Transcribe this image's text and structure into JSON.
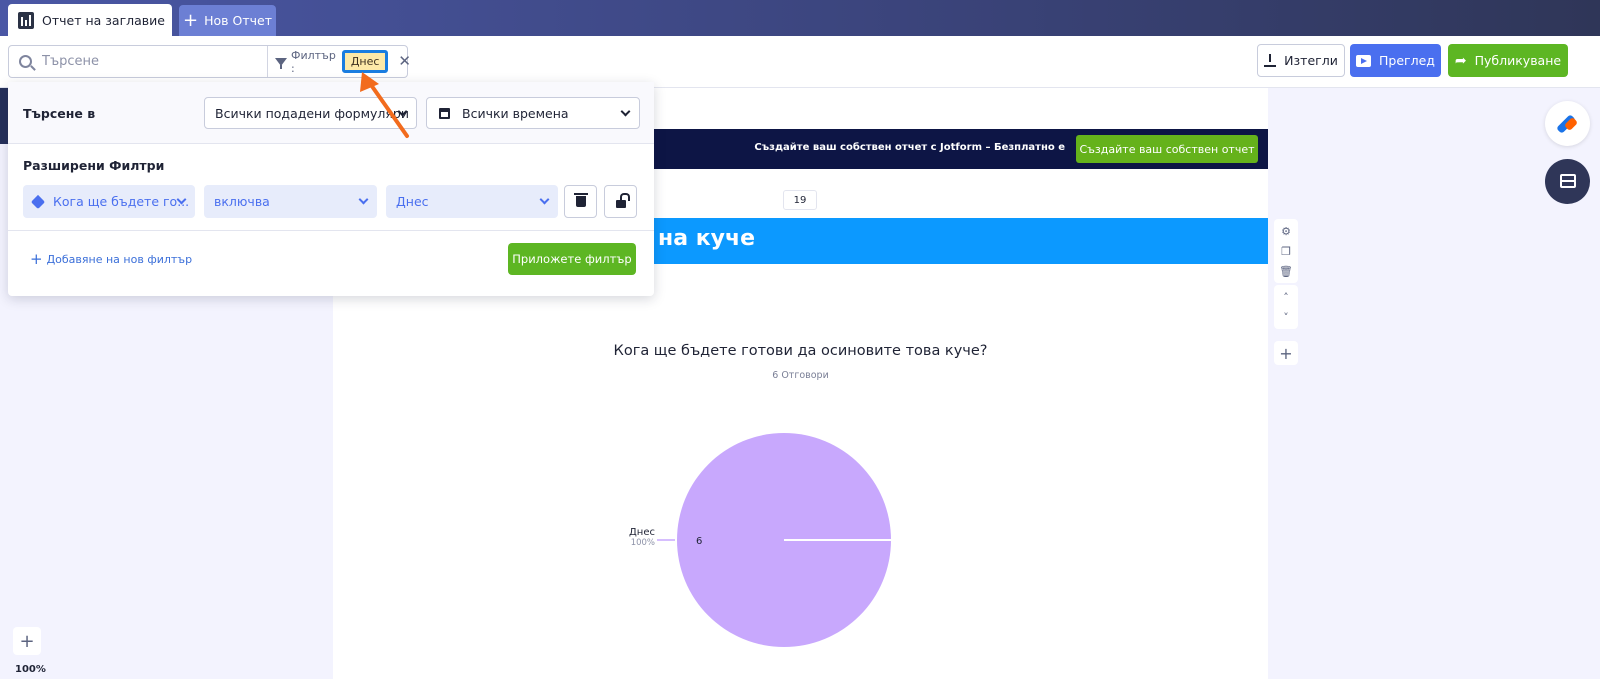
{
  "tabs": {
    "active_title": "Отчет на заглавие",
    "new_report_label": "Нов Отчет"
  },
  "toolbar": {
    "search_placeholder": "Търсене",
    "filter_label": "Филтър :",
    "filter_chip": "Днес",
    "export_label": "Изтегли",
    "preview_label": "Преглед",
    "publish_label": "Публикуване"
  },
  "filter_panel": {
    "search_in_label": "Търсене в",
    "forms_select": "Всички подадени формуляри",
    "times_select": "Всички времена",
    "advanced_label": "Разширени Филтри",
    "field_select": "Кога ще бъдете го...",
    "operator_select": "включва",
    "value_select": "Днес",
    "add_filter_label": "Добавяне на нов филтър",
    "apply_label": "Приложете филтър"
  },
  "page": {
    "banner_text": "Създайте ваш собствен отчет с Jotform – Безплатно е",
    "banner_button": "Създайте ваш собствен отчет",
    "page_number": "19",
    "title_text": "на куче"
  },
  "chart_data": {
    "type": "pie",
    "title": "Кога ще бъдете готови да осиновите това куче?",
    "subtitle": "6 Отговори",
    "slices": [
      {
        "label": "Днес",
        "value": 6,
        "percent": "100%",
        "color": "#c8a8fd"
      }
    ]
  },
  "zoom": {
    "level": "100%"
  },
  "colors": {
    "accent": "#4a6fef",
    "publish": "#5db623",
    "title_bar": "#0c99ff",
    "banner": "#0d1545",
    "annotation_arrow": "#f26b1d",
    "highlight": "#1a7de0"
  }
}
